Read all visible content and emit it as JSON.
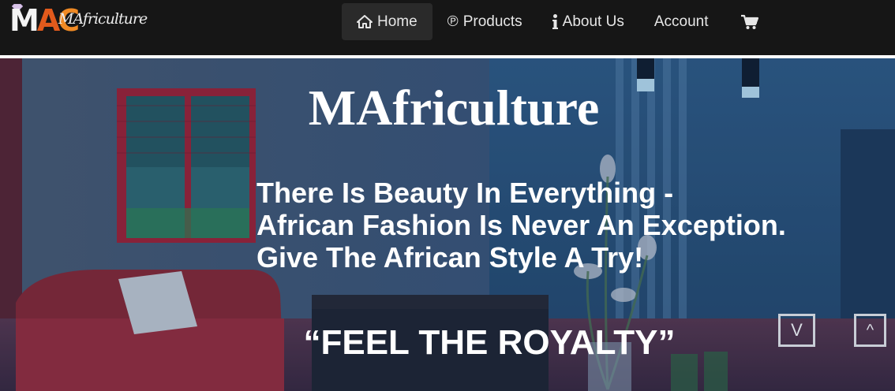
{
  "logo": {
    "mark_m": "M",
    "mark_a": "A",
    "mark_c": "C",
    "text": "MAfriculture"
  },
  "nav": {
    "items": [
      {
        "label": "Home",
        "icon": "home-icon"
      },
      {
        "label": "Products",
        "icon": "registered-icon"
      },
      {
        "label": "About Us",
        "icon": "info-icon"
      },
      {
        "label": "Account"
      },
      {
        "label": "",
        "icon": "cart-icon"
      }
    ],
    "products_symbol": "℗"
  },
  "hero": {
    "title": "MAfriculture",
    "tagline": [
      "There Is Beauty In Everything -",
      "African Fashion Is Never An Exception.",
      "Give The African Style A Try!"
    ],
    "slogan": "“FEEL THE ROYALTY”",
    "scroll_down_label": "V",
    "scroll_up_label": "^"
  },
  "colors": {
    "topbar": "#161616",
    "active_nav": "#2a2a2a",
    "logo_orange": "#e25a1c",
    "logo_amber": "#f08a24",
    "hero_blue": "#2d4f73",
    "hero_red": "#8a2a3a"
  }
}
